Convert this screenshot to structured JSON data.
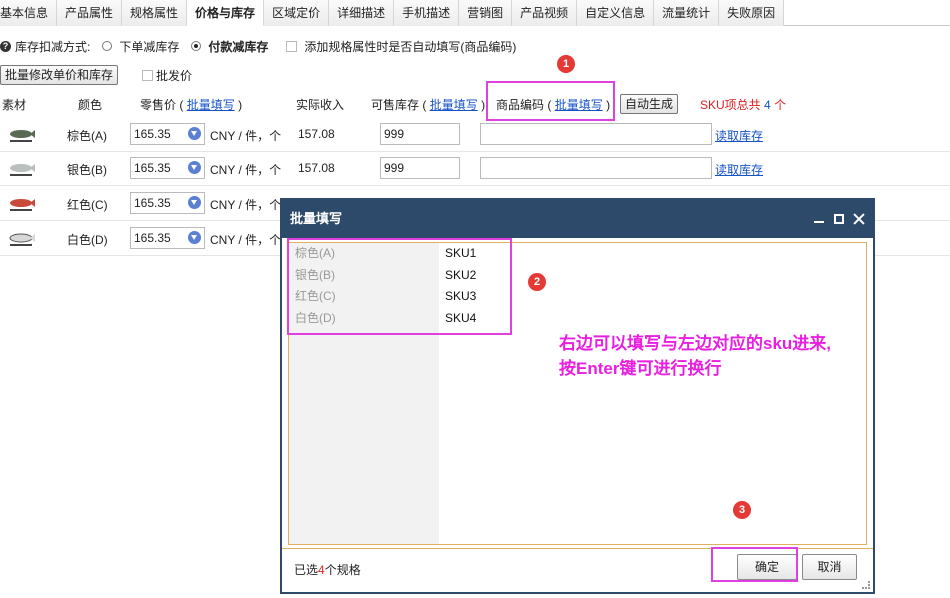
{
  "tabs": [
    {
      "label": "基本信息"
    },
    {
      "label": "产品属性"
    },
    {
      "label": "规格属性"
    },
    {
      "label": "价格与库存",
      "active": true
    },
    {
      "label": "区域定价"
    },
    {
      "label": "详细描述"
    },
    {
      "label": "手机描述"
    },
    {
      "label": "营销图"
    },
    {
      "label": "产品视频"
    },
    {
      "label": "自定义信息"
    },
    {
      "label": "流量统计"
    },
    {
      "label": "失败原因"
    }
  ],
  "stock": {
    "label": "库存扣减方式:",
    "option1": "下单减库存",
    "option2": "付款减库存",
    "option2_checked": true,
    "auto_fill_label": "添加规格属性时是否自动填写(商品编码)"
  },
  "batch": {
    "button": "批量修改单价和库存",
    "wholesale_label": "批发价"
  },
  "header": {
    "material": "素材",
    "color": "颜色",
    "retail_price": "零售价",
    "paren_open": "(",
    "paren_close": ")",
    "batch_fill": "批量填写",
    "actual_income": "实际收入",
    "stock": "可售库存",
    "sku_code": "商品编码",
    "auto_generate": "自动生成",
    "sku_total_prefix": "SKU项总共",
    "sku_total_count": "4",
    "sku_total_suffix": "个"
  },
  "rows": [
    {
      "color": "棕色(A)",
      "price": "165.35",
      "unit": "CNY / 件，个",
      "income": "157.08",
      "stock": "999",
      "read_stock": "读取库存"
    },
    {
      "color": "银色(B)",
      "price": "165.35",
      "unit": "CNY / 件，个",
      "income": "157.08",
      "stock": "999",
      "read_stock": "读取库存"
    },
    {
      "color": "红色(C)",
      "price": "165.35",
      "unit": "CNY / 件，个"
    },
    {
      "color": "白色(D)",
      "price": "165.35",
      "unit": "CNY / 件，个"
    }
  ],
  "dialog": {
    "title": "批量填写",
    "left_items": [
      "棕色(A)",
      "银色(B)",
      "红色(C)",
      "白色(D)"
    ],
    "right_items": [
      "SKU1",
      "SKU2",
      "SKU3",
      "SKU4"
    ],
    "hint_line1": "右边可以填写与左边对应的sku进来,",
    "hint_line2": "按Enter键可进行换行",
    "footer_prefix": "已选",
    "footer_count": "4",
    "footer_suffix": "个规格",
    "ok": "确定",
    "cancel": "取消"
  },
  "annotations": [
    "1",
    "2",
    "3"
  ],
  "colors": {
    "annotation_box": "#e040e0",
    "badge": "#e53935",
    "hint_text": "#e91ee0",
    "dialog_header": "#2e4a6b",
    "link": "#1552c8"
  }
}
